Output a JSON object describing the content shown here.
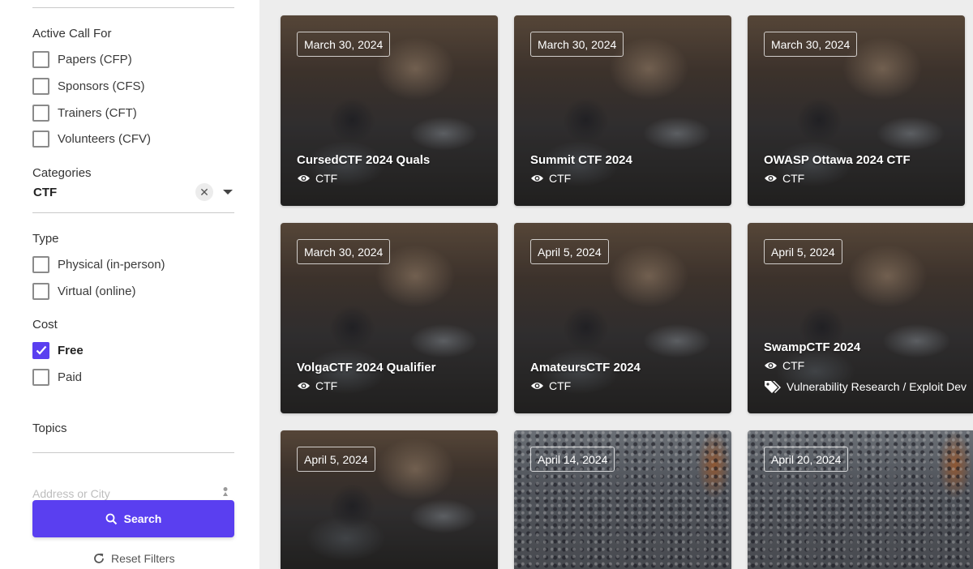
{
  "filters": {
    "active_call": {
      "heading": "Active Call For",
      "options": [
        {
          "label": "Papers (CFP)",
          "checked": false
        },
        {
          "label": "Sponsors (CFS)",
          "checked": false
        },
        {
          "label": "Trainers (CFT)",
          "checked": false
        },
        {
          "label": "Volunteers (CFV)",
          "checked": false
        }
      ]
    },
    "categories": {
      "heading": "Categories",
      "value": "CTF"
    },
    "type": {
      "heading": "Type",
      "options": [
        {
          "label": "Physical (in-person)",
          "checked": false
        },
        {
          "label": "Virtual (online)",
          "checked": false
        }
      ]
    },
    "cost": {
      "heading": "Cost",
      "options": [
        {
          "label": "Free",
          "checked": true
        },
        {
          "label": "Paid",
          "checked": false
        }
      ]
    },
    "topics": {
      "heading": "Topics"
    },
    "address": {
      "placeholder": "Address or City"
    },
    "search_label": "Search",
    "reset_label": "Reset Filters"
  },
  "colors": {
    "accent": "#5a3ff0"
  },
  "events": [
    {
      "date": "March 30, 2024",
      "title": "CursedCTF 2024 Quals",
      "category": "CTF",
      "image": "office"
    },
    {
      "date": "March 30, 2024",
      "title": "Summit CTF 2024",
      "category": "CTF",
      "image": "office"
    },
    {
      "date": "March 30, 2024",
      "title": "OWASP Ottawa 2024 CTF",
      "category": "CTF",
      "image": "office"
    },
    {
      "date": "March 30, 2024",
      "title": "VolgaCTF 2024 Qualifier",
      "category": "CTF",
      "image": "office"
    },
    {
      "date": "April 5, 2024",
      "title": "AmateursCTF 2024",
      "category": "CTF",
      "image": "office"
    },
    {
      "date": "April 5, 2024",
      "title": "SwampCTF 2024",
      "category": "CTF",
      "topic": "Vulnerability Research / Exploit Dev",
      "image": "office"
    },
    {
      "date": "April 5, 2024",
      "image": "office"
    },
    {
      "date": "April 14, 2024",
      "image": "crowd"
    },
    {
      "date": "April 20, 2024",
      "image": "crowd"
    }
  ]
}
